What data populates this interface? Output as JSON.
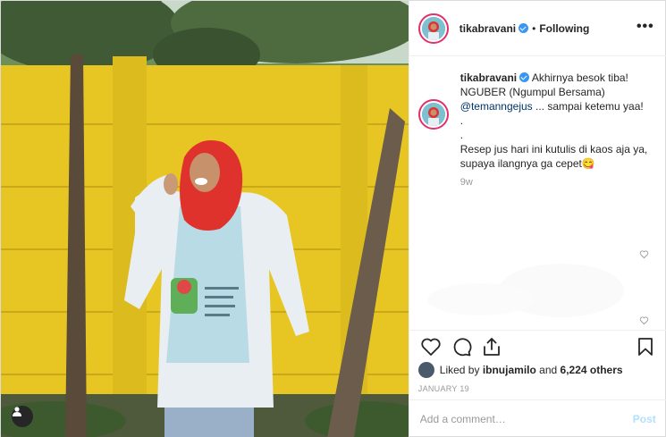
{
  "header": {
    "username": "tikabravani",
    "separator": "•",
    "follow_status": "Following",
    "more_label": "•••"
  },
  "caption": {
    "username": "tikabravani",
    "line1": "Akhirnya besok tiba! NGUBER (Ngumpul Bersama)",
    "mention": "@temanngejus",
    "line2": " ... sampai ketemu yaa!",
    "dot1": ".",
    "dot2": ".",
    "line3": "Resep jus hari ini kutulis di kaos aja ya, supaya ilangnya ga cepet😋",
    "time_ago": "9w"
  },
  "likes": {
    "prefix": "Liked by",
    "user": "ibnujamilo",
    "connector": "and",
    "others": "6,224 others"
  },
  "date": "JANUARY 19",
  "comment": {
    "placeholder": "Add a comment…",
    "post_label": "Post"
  }
}
